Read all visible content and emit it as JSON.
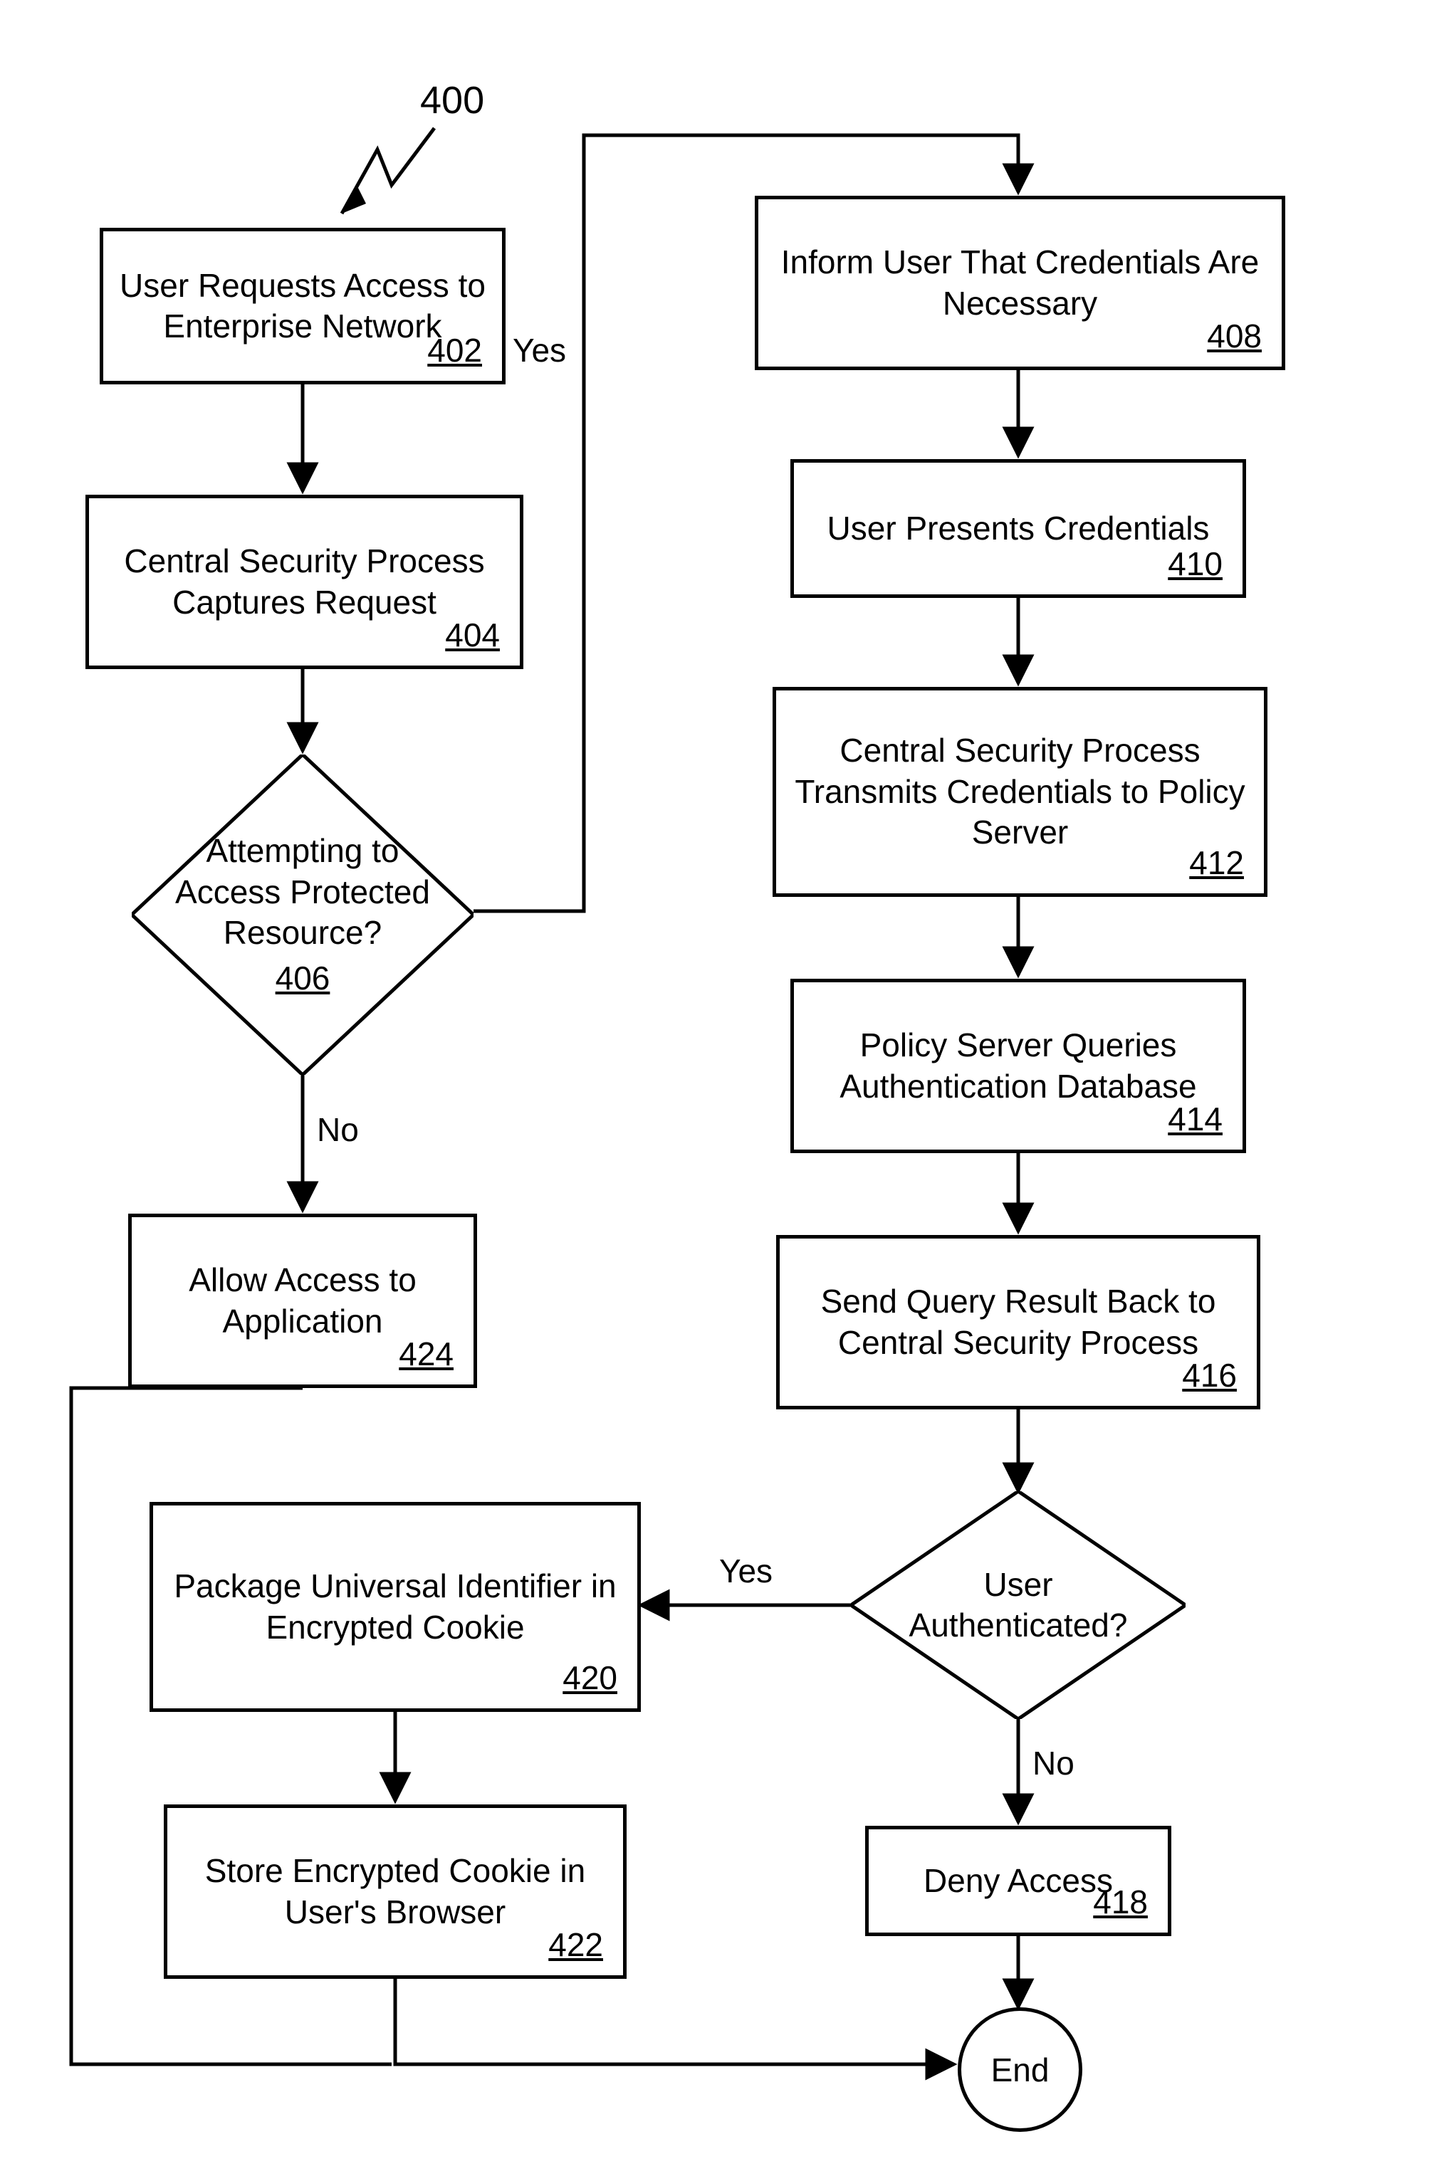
{
  "figure": {
    "number": "400"
  },
  "nodes": {
    "n402": {
      "text": "User Requests Access to Enterprise Network",
      "ref": "402"
    },
    "n404": {
      "text": "Central Security Process Captures Request",
      "ref": "404"
    },
    "n406": {
      "text": "Attempting to Access Protected Resource?",
      "ref": "406"
    },
    "n408": {
      "text": "Inform User That Credentials Are Necessary",
      "ref": "408"
    },
    "n410": {
      "text": "User Presents Credentials",
      "ref": "410"
    },
    "n412": {
      "text": "Central Security Process Transmits Credentials to Policy Server",
      "ref": "412"
    },
    "n414": {
      "text": "Policy Server Queries Authentication Database",
      "ref": "414"
    },
    "n416": {
      "text": "Send Query Result Back to Central Security Process",
      "ref": "416"
    },
    "nUserAuth": {
      "text": "User Authenticated?"
    },
    "n418": {
      "text": "Deny Access",
      "ref": "418"
    },
    "n420": {
      "text": "Package Universal Identifier in Encrypted Cookie",
      "ref": "420"
    },
    "n422": {
      "text": "Store Encrypted Cookie in User's Browser",
      "ref": "422"
    },
    "n424": {
      "text": "Allow Access to Application",
      "ref": "424"
    },
    "end": {
      "text": "End"
    }
  },
  "edges": {
    "yes1": "Yes",
    "no1": "No",
    "yes2": "Yes",
    "no2": "No"
  }
}
